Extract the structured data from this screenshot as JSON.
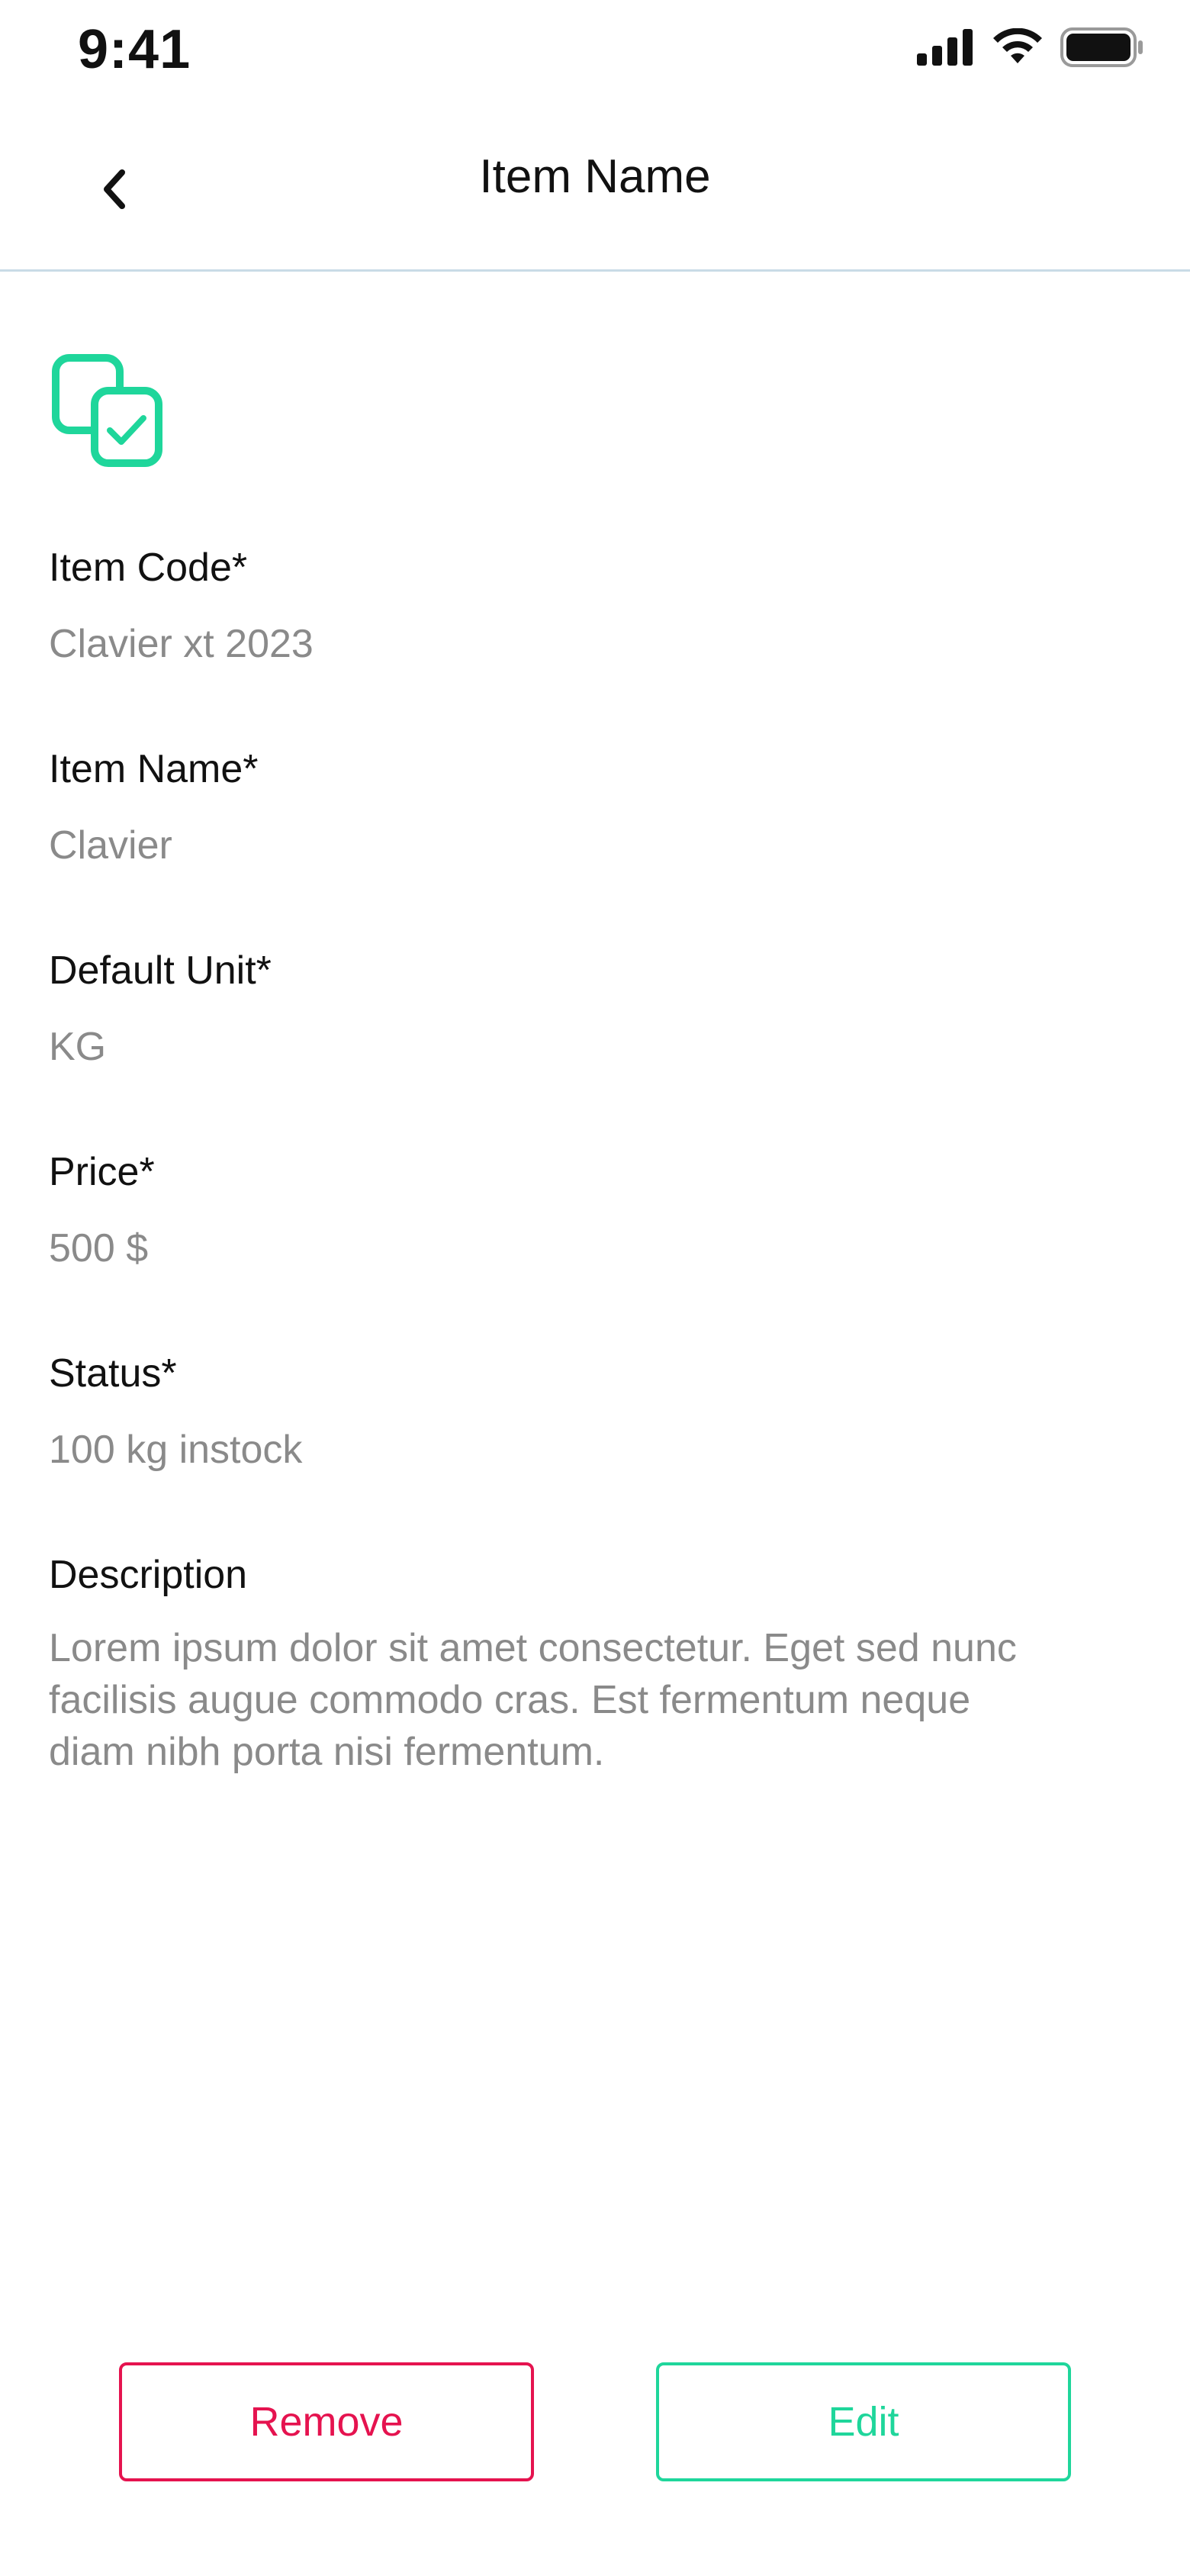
{
  "status_bar": {
    "time": "9:41",
    "icons": [
      "signal-icon",
      "wifi-icon",
      "battery-icon"
    ]
  },
  "header": {
    "title": "Item Name",
    "back_icon": "chevron-left-icon"
  },
  "item_icon": "duplicate-check-icon",
  "fields": {
    "item_code": {
      "label": "Item Code*",
      "value": "Clavier xt 2023"
    },
    "item_name": {
      "label": "Item Name*",
      "value": "Clavier"
    },
    "default_unit": {
      "label": "Default Unit*",
      "value": "KG"
    },
    "price": {
      "label": "Price*",
      "value": "500 $"
    },
    "status": {
      "label": "Status*",
      "value": "100 kg instock"
    },
    "description": {
      "label": "Description",
      "lines": [
        "Lorem ipsum dolor sit amet consectetur. Eget sed nunc",
        "facilisis augue commodo cras. Est fermentum neque",
        "diam nibh porta nisi fermentum."
      ]
    }
  },
  "actions": {
    "remove_label": "Remove",
    "edit_label": "Edit"
  },
  "colors": {
    "accent_green": "#1fd69b",
    "danger_red": "#e5134f",
    "muted_text": "#8a8a8a",
    "divider": "#c9dbe6"
  }
}
